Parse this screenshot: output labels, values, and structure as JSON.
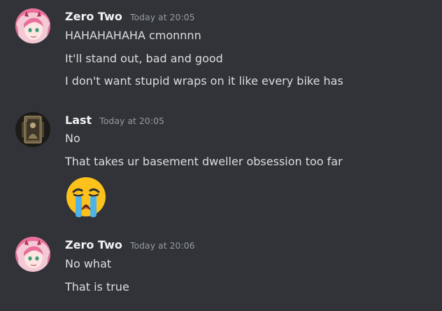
{
  "messages": [
    {
      "author": "Zero Two",
      "time": "Today at 20:05",
      "avatar": "pink-hair-anime-avatar",
      "lines": [
        "HAHAHAHAHA cmonnnn",
        "It'll stand out, bad and good",
        "I don't want stupid wraps on it like every bike has"
      ]
    },
    {
      "author": "Last",
      "time": "Today at 20:05",
      "avatar": "playing-card-avatar",
      "lines": [
        "No",
        "That takes ur basement dweller obsession too far"
      ],
      "emoji": "loudly-crying-face-emoji"
    },
    {
      "author": "Zero Two",
      "time": "Today at 20:06",
      "avatar": "pink-hair-anime-avatar",
      "lines": [
        "No what",
        "That is true"
      ]
    }
  ],
  "colors": {
    "background": "#313338",
    "username": "#f2f3f5",
    "text": "#dbdee1",
    "timestamp": "#949ba4"
  }
}
